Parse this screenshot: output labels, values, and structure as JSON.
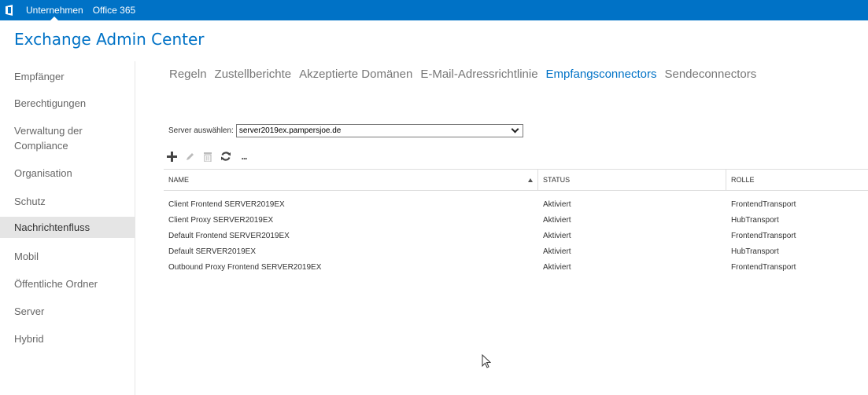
{
  "topbar": {
    "links": [
      "Unternehmen",
      "Office 365"
    ]
  },
  "app_title": "Exchange Admin Center",
  "sidebar": {
    "items": [
      {
        "label": "Empfänger"
      },
      {
        "label": "Berechtigungen"
      },
      {
        "label": "Verwaltung der Compliance"
      },
      {
        "label": "Organisation"
      },
      {
        "label": "Schutz"
      },
      {
        "label": "Nachrichtenfluss",
        "selected": true
      },
      {
        "label": "Mobil"
      },
      {
        "label": "Öffentliche Ordner"
      },
      {
        "label": "Server"
      },
      {
        "label": "Hybrid"
      }
    ]
  },
  "tabs": [
    {
      "label": "Regeln"
    },
    {
      "label": "Zustellberichte"
    },
    {
      "label": "Akzeptierte Domänen"
    },
    {
      "label": "E-Mail-Adressrichtlinie"
    },
    {
      "label": "Empfangsconnectors",
      "active": true
    },
    {
      "label": "Sendeconnectors"
    }
  ],
  "server_select": {
    "label": "Server auswählen:",
    "value": "server2019ex.pampersjoe.de"
  },
  "toolbar": {
    "icons": [
      "add-icon",
      "edit-icon",
      "delete-icon",
      "refresh-icon",
      "more-icon"
    ],
    "more_label": "..."
  },
  "table": {
    "columns": [
      "NAME",
      "STATUS",
      "ROLLE"
    ],
    "rows": [
      [
        "Client Frontend SERVER2019EX",
        "Aktiviert",
        "FrontendTransport"
      ],
      [
        "Client Proxy SERVER2019EX",
        "Aktiviert",
        "HubTransport"
      ],
      [
        "Default Frontend SERVER2019EX",
        "Aktiviert",
        "FrontendTransport"
      ],
      [
        "Default SERVER2019EX",
        "Aktiviert",
        "HubTransport"
      ],
      [
        "Outbound Proxy Frontend SERVER2019EX",
        "Aktiviert",
        "FrontendTransport"
      ]
    ]
  },
  "colors": {
    "accent": "#0072c6",
    "selected_bg": "#e5e5e5"
  }
}
